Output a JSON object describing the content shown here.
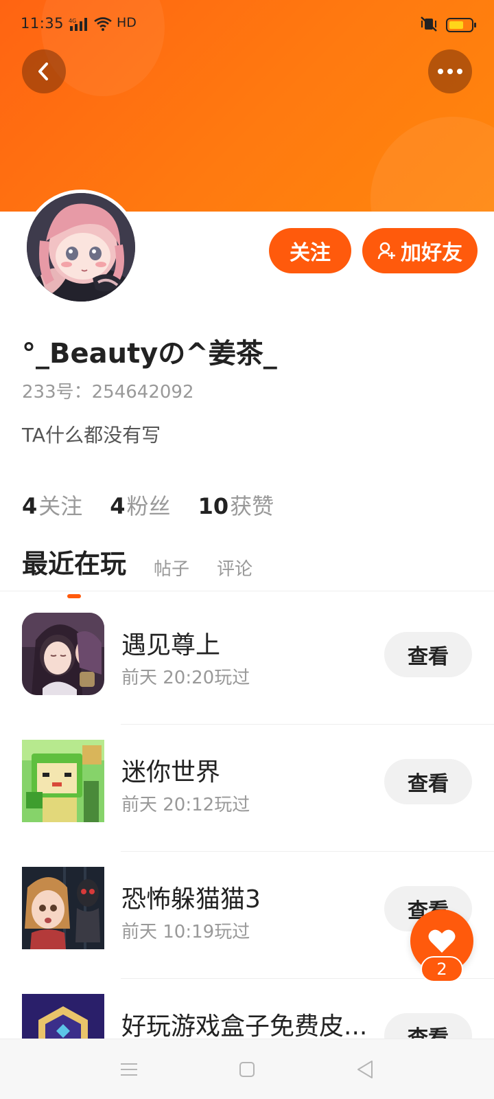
{
  "status_bar": {
    "time": "11:35",
    "network": "4G",
    "hd": "HD",
    "battery_color": "#ffd51a"
  },
  "header": {
    "back_icon": "chevron-left-icon",
    "more_icon": "more-dots-icon",
    "banner_color": "#ff6a12"
  },
  "profile": {
    "username": "°_Beautyの^姜茶_",
    "user_id": "233号：254642092",
    "bio": "TA什么都没有写",
    "follow_label": "关注",
    "add_friend_label": "加好友",
    "accent_color": "#ff5a0c"
  },
  "stats": [
    {
      "num": "4",
      "label": "关注"
    },
    {
      "num": "4",
      "label": "粉丝"
    },
    {
      "num": "10",
      "label": "获赞"
    }
  ],
  "tabs": [
    {
      "label": "最近在玩",
      "active": true
    },
    {
      "label": "帖子",
      "active": false
    },
    {
      "label": "评论",
      "active": false
    }
  ],
  "games": [
    {
      "name": "遇见尊上",
      "time": "前天 20:20玩过",
      "button": "查看",
      "icon": "game-icon-yujian"
    },
    {
      "name": "迷你世界",
      "time": "前天 20:12玩过",
      "button": "查看",
      "icon": "game-icon-mini-world"
    },
    {
      "name": "恐怖躲猫猫3",
      "time": "前天 10:19玩过",
      "button": "查看",
      "icon": "game-icon-hide-seek"
    },
    {
      "name": "好玩游戏盒子免费皮...",
      "time": "",
      "button": "查看",
      "icon": "game-icon-box"
    }
  ],
  "fab": {
    "icon": "heart-icon",
    "count": "2"
  },
  "nav_bar": {
    "menu_icon": "menu-icon",
    "home_icon": "home-square-icon",
    "back_icon": "back-triangle-icon"
  }
}
